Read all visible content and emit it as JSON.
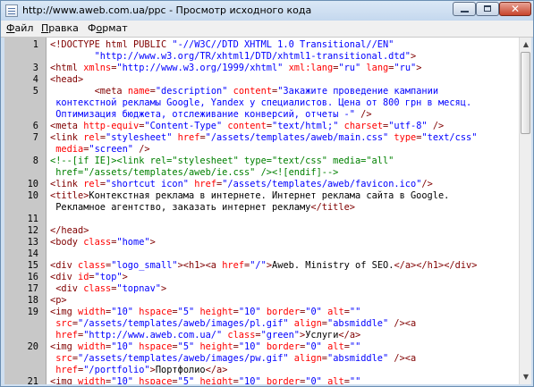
{
  "window": {
    "title": "http://www.aweb.com.ua/ppc - Просмотр исходного кода",
    "close_glyph": "✕"
  },
  "menu": [
    {
      "label": "Файл",
      "accel": "Ф",
      "rest": "айл"
    },
    {
      "label": "Правка",
      "accel": "П",
      "rest": "равка"
    },
    {
      "label": "Формат",
      "accel": "о",
      "prefix": "Ф",
      "rest": "рмат"
    }
  ],
  "colors": {
    "tag": "#800000",
    "attr": "#ff0000",
    "value": "#0000ff",
    "text": "#000000",
    "comment": "#008000",
    "gutter": "#c8c8c8"
  },
  "scrollbar": {
    "up_glyph": "▲",
    "down_glyph": "▼"
  },
  "source_lines": [
    {
      "num": "1",
      "rows": [
        [
          [
            "tag",
            "<!DOCTYPE html PUBLIC "
          ],
          [
            "val",
            "\"-//W3C//DTD XHTML 1.0 Transitional//EN\""
          ]
        ],
        [
          [
            "val",
            "        \"http://www.w3.org/TR/xhtml1/DTD/xhtml1-transitional.dtd\""
          ],
          [
            "tag",
            ">"
          ]
        ]
      ]
    },
    {
      "num": "3",
      "rows": [
        [
          [
            "tag",
            "<html "
          ],
          [
            "attr",
            "xmlns"
          ],
          [
            "tag",
            "="
          ],
          [
            "val",
            "\"http://www.w3.org/1999/xhtml\""
          ],
          [
            "tag",
            " "
          ],
          [
            "attr",
            "xml:lang"
          ],
          [
            "tag",
            "="
          ],
          [
            "val",
            "\"ru\""
          ],
          [
            "tag",
            " "
          ],
          [
            "attr",
            "lang"
          ],
          [
            "tag",
            "="
          ],
          [
            "val",
            "\"ru\""
          ],
          [
            "tag",
            ">"
          ]
        ]
      ]
    },
    {
      "num": "4",
      "rows": [
        [
          [
            "tag",
            "<head>"
          ]
        ]
      ]
    },
    {
      "num": "5",
      "rows": [
        [
          [
            "txt",
            "        "
          ],
          [
            "tag",
            "<meta "
          ],
          [
            "attr",
            "name"
          ],
          [
            "tag",
            "="
          ],
          [
            "val",
            "\"description\""
          ],
          [
            "tag",
            " "
          ],
          [
            "attr",
            "content"
          ],
          [
            "tag",
            "="
          ],
          [
            "val",
            "\"Закажите проведение кампании"
          ]
        ],
        [
          [
            "val",
            " контекстной рекламы Google, Yandex у специалистов. Цена от 800 грн в месяц."
          ]
        ],
        [
          [
            "val",
            " Оптимизация бюджета, отслеживание конверсий, отчеты -\""
          ],
          [
            "tag",
            " />"
          ]
        ]
      ]
    },
    {
      "num": "6",
      "rows": [
        [
          [
            "tag",
            "<meta "
          ],
          [
            "attr",
            "http-equiv"
          ],
          [
            "tag",
            "="
          ],
          [
            "val",
            "\"Content-Type\""
          ],
          [
            "tag",
            " "
          ],
          [
            "attr",
            "content"
          ],
          [
            "tag",
            "="
          ],
          [
            "val",
            "\"text/html;\""
          ],
          [
            "tag",
            " "
          ],
          [
            "attr",
            "charset"
          ],
          [
            "tag",
            "="
          ],
          [
            "val",
            "\"utf-8\""
          ],
          [
            "tag",
            " />"
          ]
        ]
      ]
    },
    {
      "num": "7",
      "rows": [
        [
          [
            "tag",
            "<link "
          ],
          [
            "attr",
            "rel"
          ],
          [
            "tag",
            "="
          ],
          [
            "val",
            "\"stylesheet\""
          ],
          [
            "tag",
            " "
          ],
          [
            "attr",
            "href"
          ],
          [
            "tag",
            "="
          ],
          [
            "val",
            "\"/assets/templates/aweb/main.css\""
          ],
          [
            "tag",
            " "
          ],
          [
            "attr",
            "type"
          ],
          [
            "tag",
            "="
          ],
          [
            "val",
            "\"text/css\""
          ]
        ],
        [
          [
            "tag",
            " "
          ],
          [
            "attr",
            "media"
          ],
          [
            "tag",
            "="
          ],
          [
            "val",
            "\"screen\""
          ],
          [
            "tag",
            " />"
          ]
        ]
      ]
    },
    {
      "num": "8",
      "rows": [
        [
          [
            "comment",
            "<!--[if IE]><link rel=\"stylesheet\" type=\"text/css\" media=\"all\""
          ]
        ],
        [
          [
            "comment",
            " href=\"/assets/templates/aweb/ie.css\" /><![endif]-->"
          ]
        ]
      ]
    },
    {
      "num": "10",
      "rows": [
        [
          [
            "tag",
            "<link "
          ],
          [
            "attr",
            "rel"
          ],
          [
            "tag",
            "="
          ],
          [
            "val",
            "\"shortcut icon\""
          ],
          [
            "tag",
            " "
          ],
          [
            "attr",
            "href"
          ],
          [
            "tag",
            "="
          ],
          [
            "val",
            "\"/assets/templates/aweb/favicon.ico\""
          ],
          [
            "tag",
            "/>"
          ]
        ]
      ]
    },
    {
      "num": "10",
      "rows": [
        [
          [
            "tag",
            "<title>"
          ],
          [
            "txt",
            "Контекстная реклама в интернете. Интернет реклама сайта в Google."
          ]
        ],
        [
          [
            "txt",
            " Рекламное агентство, заказать интернет рекламу"
          ],
          [
            "tag",
            "</title>"
          ]
        ]
      ]
    },
    {
      "num": "11",
      "rows": [
        []
      ]
    },
    {
      "num": "12",
      "rows": [
        [
          [
            "tag",
            "</head>"
          ]
        ]
      ]
    },
    {
      "num": "13",
      "rows": [
        [
          [
            "tag",
            "<body "
          ],
          [
            "attr",
            "class"
          ],
          [
            "tag",
            "="
          ],
          [
            "val",
            "\"home\""
          ],
          [
            "tag",
            ">"
          ]
        ]
      ]
    },
    {
      "num": "14",
      "rows": [
        []
      ]
    },
    {
      "num": "15",
      "rows": [
        [
          [
            "tag",
            "<div "
          ],
          [
            "attr",
            "class"
          ],
          [
            "tag",
            "="
          ],
          [
            "val",
            "\"logo_small\""
          ],
          [
            "tag",
            "><h1><a "
          ],
          [
            "attr",
            "href"
          ],
          [
            "tag",
            "="
          ],
          [
            "val",
            "\"/\""
          ],
          [
            "tag",
            ">"
          ],
          [
            "txt",
            "Aweb. Ministry of SEO."
          ],
          [
            "tag",
            "</a></h1></div>"
          ]
        ]
      ]
    },
    {
      "num": "16",
      "rows": [
        [
          [
            "tag",
            "<div "
          ],
          [
            "attr",
            "id"
          ],
          [
            "tag",
            "="
          ],
          [
            "val",
            "\"top\""
          ],
          [
            "tag",
            ">"
          ]
        ]
      ]
    },
    {
      "num": "17",
      "rows": [
        [
          [
            "tag",
            " <div "
          ],
          [
            "attr",
            "class"
          ],
          [
            "tag",
            "="
          ],
          [
            "val",
            "\"topnav\""
          ],
          [
            "tag",
            ">"
          ]
        ]
      ]
    },
    {
      "num": "18",
      "rows": [
        [
          [
            "tag",
            "<p>"
          ]
        ]
      ]
    },
    {
      "num": "19",
      "rows": [
        [
          [
            "tag",
            "<img "
          ],
          [
            "attr",
            "width"
          ],
          [
            "tag",
            "="
          ],
          [
            "val",
            "\"10\""
          ],
          [
            "tag",
            " "
          ],
          [
            "attr",
            "hspace"
          ],
          [
            "tag",
            "="
          ],
          [
            "val",
            "\"5\""
          ],
          [
            "tag",
            " "
          ],
          [
            "attr",
            "height"
          ],
          [
            "tag",
            "="
          ],
          [
            "val",
            "\"10\""
          ],
          [
            "tag",
            " "
          ],
          [
            "attr",
            "border"
          ],
          [
            "tag",
            "="
          ],
          [
            "val",
            "\"0\""
          ],
          [
            "tag",
            " "
          ],
          [
            "attr",
            "alt"
          ],
          [
            "tag",
            "="
          ],
          [
            "val",
            "\"\""
          ]
        ],
        [
          [
            "tag",
            " "
          ],
          [
            "attr",
            "src"
          ],
          [
            "tag",
            "="
          ],
          [
            "val",
            "\"/assets/templates/aweb/images/pl.gif\""
          ],
          [
            "tag",
            " "
          ],
          [
            "attr",
            "align"
          ],
          [
            "tag",
            "="
          ],
          [
            "val",
            "\"absmiddle\""
          ],
          [
            "tag",
            " /><a"
          ]
        ],
        [
          [
            "tag",
            " "
          ],
          [
            "attr",
            "href"
          ],
          [
            "tag",
            "="
          ],
          [
            "val",
            "\"http://www.aweb.com.ua/\""
          ],
          [
            "tag",
            " "
          ],
          [
            "attr",
            "class"
          ],
          [
            "tag",
            "="
          ],
          [
            "val",
            "\"green\""
          ],
          [
            "tag",
            ">"
          ],
          [
            "txt",
            "Услуги"
          ],
          [
            "tag",
            "</a>"
          ]
        ]
      ]
    },
    {
      "num": "20",
      "rows": [
        [
          [
            "tag",
            "<img "
          ],
          [
            "attr",
            "width"
          ],
          [
            "tag",
            "="
          ],
          [
            "val",
            "\"10\""
          ],
          [
            "tag",
            " "
          ],
          [
            "attr",
            "hspace"
          ],
          [
            "tag",
            "="
          ],
          [
            "val",
            "\"5\""
          ],
          [
            "tag",
            " "
          ],
          [
            "attr",
            "height"
          ],
          [
            "tag",
            "="
          ],
          [
            "val",
            "\"10\""
          ],
          [
            "tag",
            " "
          ],
          [
            "attr",
            "border"
          ],
          [
            "tag",
            "="
          ],
          [
            "val",
            "\"0\""
          ],
          [
            "tag",
            " "
          ],
          [
            "attr",
            "alt"
          ],
          [
            "tag",
            "="
          ],
          [
            "val",
            "\"\""
          ]
        ],
        [
          [
            "tag",
            " "
          ],
          [
            "attr",
            "src"
          ],
          [
            "tag",
            "="
          ],
          [
            "val",
            "\"/assets/templates/aweb/images/pw.gif\""
          ],
          [
            "tag",
            " "
          ],
          [
            "attr",
            "align"
          ],
          [
            "tag",
            "="
          ],
          [
            "val",
            "\"absmiddle\""
          ],
          [
            "tag",
            " /><a"
          ]
        ],
        [
          [
            "tag",
            " "
          ],
          [
            "attr",
            "href"
          ],
          [
            "tag",
            "="
          ],
          [
            "val",
            "\"/portfolio\""
          ],
          [
            "tag",
            ">"
          ],
          [
            "txt",
            "Портфолио"
          ],
          [
            "tag",
            "</a>"
          ]
        ]
      ]
    },
    {
      "num": "21",
      "rows": [
        [
          [
            "tag",
            "<img "
          ],
          [
            "attr",
            "width"
          ],
          [
            "tag",
            "="
          ],
          [
            "val",
            "\"10\""
          ],
          [
            "tag",
            " "
          ],
          [
            "attr",
            "hspace"
          ],
          [
            "tag",
            "="
          ],
          [
            "val",
            "\"5\""
          ],
          [
            "tag",
            " "
          ],
          [
            "attr",
            "height"
          ],
          [
            "tag",
            "="
          ],
          [
            "val",
            "\"10\""
          ],
          [
            "tag",
            " "
          ],
          [
            "attr",
            "border"
          ],
          [
            "tag",
            "="
          ],
          [
            "val",
            "\"0\""
          ],
          [
            "tag",
            " "
          ],
          [
            "attr",
            "alt"
          ],
          [
            "tag",
            "="
          ],
          [
            "val",
            "\"\""
          ]
        ],
        [
          [
            "tag",
            " "
          ],
          [
            "attr",
            "src"
          ],
          [
            "tag",
            "="
          ],
          [
            "val",
            "\"/assets/templates/aweb/images/pw.gif\""
          ],
          [
            "tag",
            " "
          ],
          [
            "attr",
            "align"
          ],
          [
            "tag",
            "="
          ],
          [
            "val",
            "\"absmiddle\""
          ],
          [
            "tag",
            " /><a"
          ]
        ]
      ]
    }
  ]
}
